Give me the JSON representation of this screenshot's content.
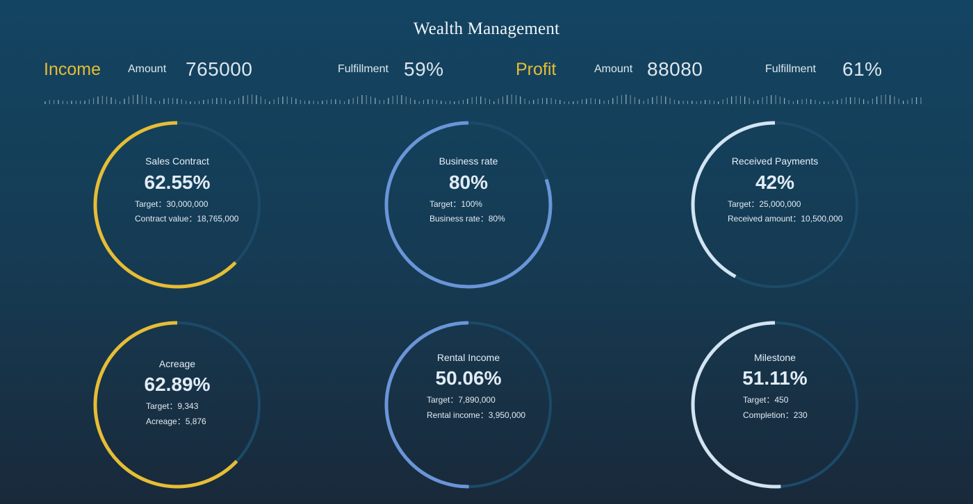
{
  "title": "Wealth Management",
  "summary": {
    "income": {
      "label": "Income",
      "amount_label": "Amount",
      "amount": "765000",
      "fulfillment_label": "Fulfillment",
      "fulfillment": "59%"
    },
    "profit": {
      "label": "Profit",
      "amount_label": "Amount",
      "amount": "88080",
      "fulfillment_label": "Fulfillment",
      "fulfillment": "61%"
    }
  },
  "colors": {
    "gold": "#e6bd35",
    "blue": "#6a95d8",
    "white": "#d2e4f2",
    "track": "#1c4a68"
  },
  "gauges": [
    {
      "title": "Sales Contract",
      "percent": "62.55%",
      "value": 0.6255,
      "color": "gold",
      "line1": "Target：30,000,000",
      "line2": "Contract value：18,765,000"
    },
    {
      "title": "Business rate",
      "percent": "80%",
      "value": 0.8,
      "color": "blue",
      "line1": "Target：100%",
      "line2": "Business rate：80%"
    },
    {
      "title": "Received Payments",
      "percent": "42%",
      "value": 0.42,
      "color": "white",
      "line1": "Target：25,000,000",
      "line2": "Received amount：10,500,000"
    },
    {
      "title": "Acreage",
      "percent": "62.89%",
      "value": 0.6289,
      "color": "gold",
      "line1": "Target：9,343",
      "line2": "Acreage：5,876"
    },
    {
      "title": "Rental Income",
      "percent": "50.06%",
      "value": 0.5006,
      "color": "blue",
      "line1": "Target：7,890,000",
      "line2": "Rental income：3,950,000"
    },
    {
      "title": "Milestone",
      "percent": "51.11%",
      "value": 0.5111,
      "color": "white",
      "line1": "Target：450",
      "line2": "Completion：230"
    }
  ]
}
